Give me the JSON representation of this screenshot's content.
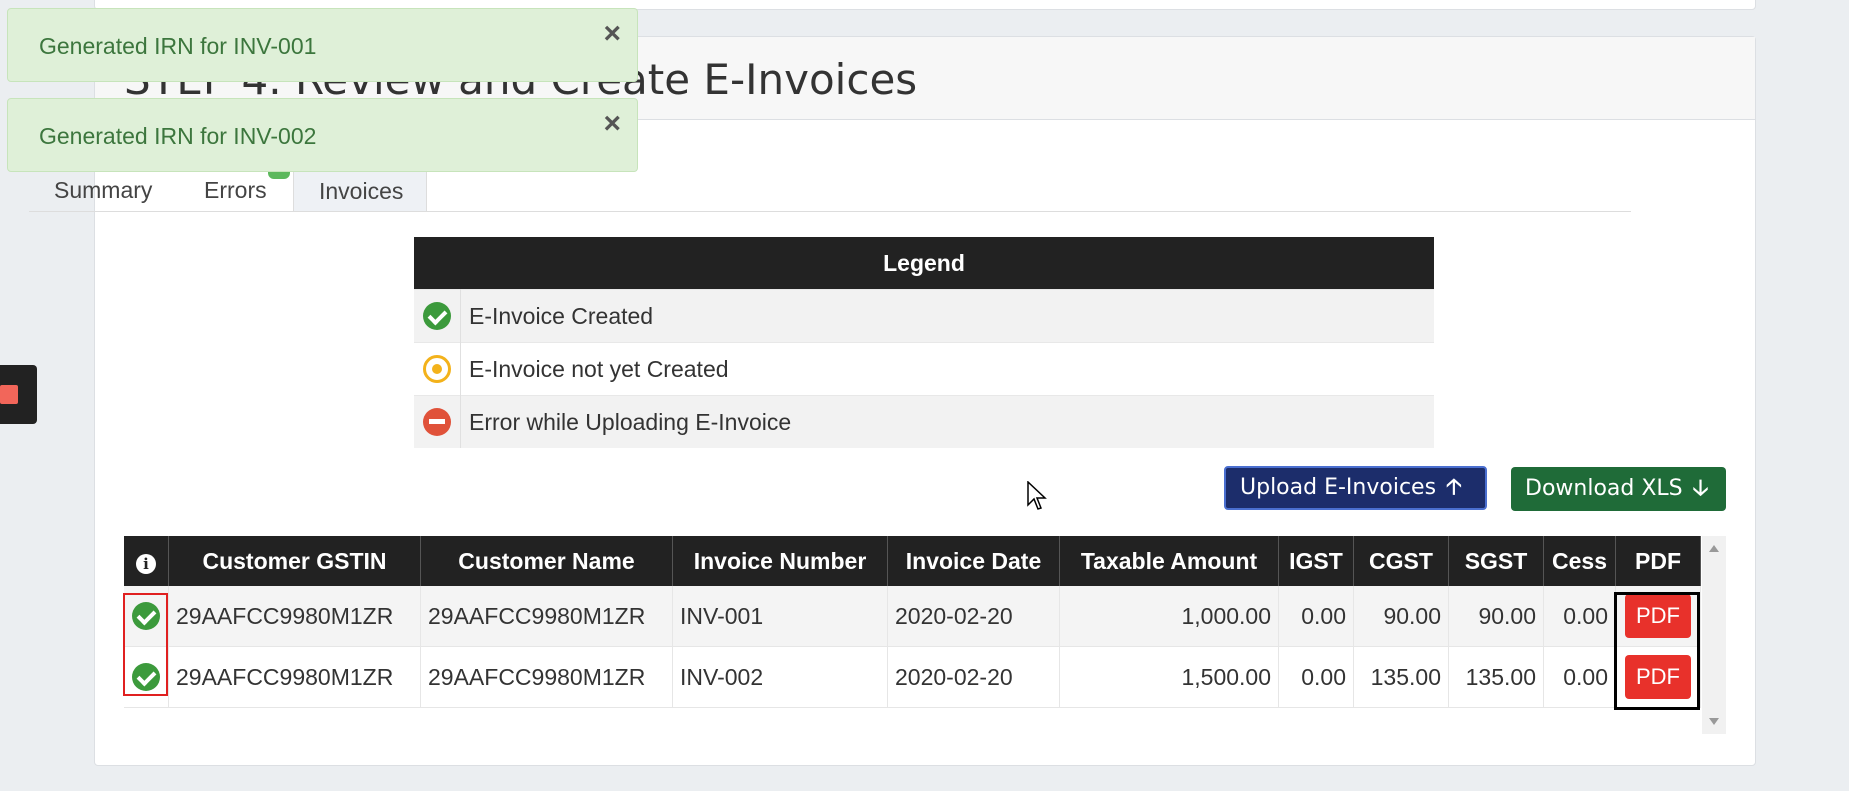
{
  "page": {
    "step_title": "STEP 4. Review and Create E-Invoices"
  },
  "tabs": [
    {
      "label": "Summary"
    },
    {
      "label": "Errors"
    },
    {
      "label": "Invoices"
    }
  ],
  "legend": {
    "title": "Legend",
    "items": [
      {
        "icon": "check-circle-icon",
        "label": "E-Invoice Created"
      },
      {
        "icon": "dot-circle-icon",
        "label": "E-Invoice not yet Created"
      },
      {
        "icon": "minus-circle-icon",
        "label": "Error while Uploading E-Invoice"
      }
    ]
  },
  "buttons": {
    "upload": "Upload E-Invoices",
    "download": "Download XLS"
  },
  "table": {
    "columns": [
      "Customer GSTIN",
      "Customer Name",
      "Invoice Number",
      "Invoice Date",
      "Taxable Amount",
      "IGST",
      "CGST",
      "SGST",
      "Cess",
      "PDF"
    ],
    "rows": [
      {
        "status": "created",
        "gstin": "29AAFCC9980M1ZR",
        "name": "29AAFCC9980M1ZR",
        "invoice_number": "INV-001",
        "invoice_date": "2020-02-20",
        "taxable": "1,000.00",
        "igst": "0.00",
        "cgst": "90.00",
        "sgst": "90.00",
        "cess": "0.00",
        "pdf": "PDF"
      },
      {
        "status": "created",
        "gstin": "29AAFCC9980M1ZR",
        "name": "29AAFCC9980M1ZR",
        "invoice_number": "INV-002",
        "invoice_date": "2020-02-20",
        "taxable": "1,500.00",
        "igst": "0.00",
        "cgst": "135.00",
        "sgst": "135.00",
        "cess": "0.00",
        "pdf": "PDF"
      }
    ]
  },
  "toasts": [
    {
      "message": "Generated IRN for INV-001",
      "close": "×"
    },
    {
      "message": "Generated IRN for INV-002",
      "close": "×"
    }
  ],
  "colors": {
    "success_toast_bg": "#dff0d8",
    "upload_button": "#1c2d6b",
    "download_button": "#1f6b38",
    "pdf_button": "#e8312b",
    "status_ok": "#3c9a3c"
  }
}
